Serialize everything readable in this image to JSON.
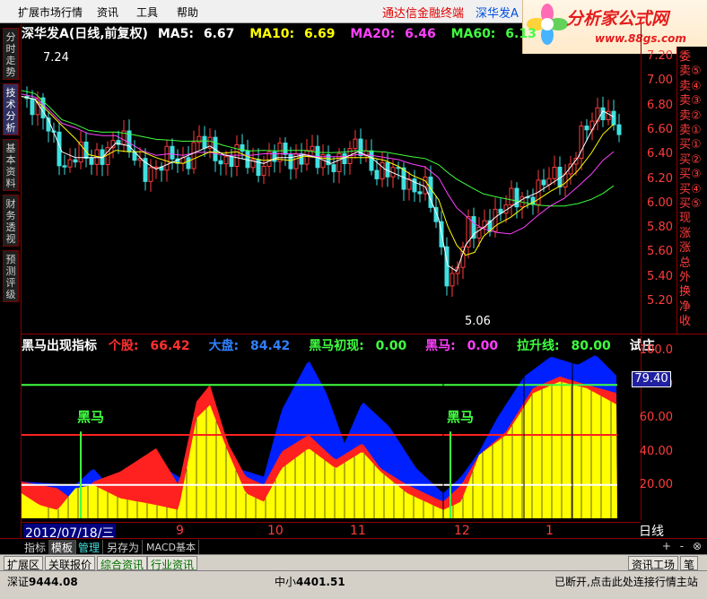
{
  "menu": {
    "items": [
      "扩展市场行情",
      "资讯",
      "工具",
      "帮助"
    ]
  },
  "window": {
    "brand_title": "通达信金融终端",
    "stock_title": "深华发A"
  },
  "logo": {
    "text": "分析家公式网",
    "url": "www.88gs.com"
  },
  "left_tabs": [
    "分时走势",
    "技术分析",
    "基本资料",
    "财务透视",
    "预测评级"
  ],
  "price_chart": {
    "title": "深华发A",
    "mode": "(日线,前复权)",
    "ma": [
      {
        "label": "MA5:",
        "value": "6.67",
        "color": "#ffffff"
      },
      {
        "label": "MA10:",
        "value": "6.69",
        "color": "#ffff00"
      },
      {
        "label": "MA20:",
        "value": "6.46",
        "color": "#ff40ff"
      },
      {
        "label": "MA60:",
        "value": "6.13",
        "color": "#40ff40"
      }
    ],
    "high_marker": "7.24",
    "low_marker": "5.06",
    "price_axis": [
      "7.20",
      "7.00",
      "6.80",
      "6.60",
      "6.40",
      "6.20",
      "6.00",
      "5.80",
      "5.60",
      "5.40",
      "5.20"
    ]
  },
  "order_book": [
    "委",
    "卖⑤",
    "卖④",
    "卖③",
    "卖②",
    "卖①",
    "买①",
    "买②",
    "买③",
    "买④",
    "买⑤",
    "现",
    "涨",
    "涨",
    "总",
    "外",
    "换",
    "净",
    "收"
  ],
  "indicator": {
    "name": "黑马出现指标",
    "items": [
      {
        "label": "个股:",
        "value": "66.42",
        "color": "#ff3030"
      },
      {
        "label": "大盘:",
        "value": "84.42",
        "color": "#3080ff"
      },
      {
        "label": "黑马初现:",
        "value": "0.00",
        "color": "#40ff40"
      },
      {
        "label": "黑马:",
        "value": "0.00",
        "color": "#ff40ff"
      },
      {
        "label": "拉升线:",
        "value": "80.00",
        "color": "#40ff40"
      }
    ],
    "extra": "试庄",
    "axis": [
      "100.0",
      "80.00",
      "60.00",
      "40.00",
      "20.00"
    ],
    "current_value": "79.40",
    "signal_label": "黑马"
  },
  "date_bar": {
    "current": "2012/07/18/三",
    "months": [
      "9",
      "10",
      "11",
      "12",
      "1"
    ],
    "period": "日线"
  },
  "bottom_tabs": [
    "指标",
    "模板",
    "管理",
    "另存为",
    "MACD基本"
  ],
  "zoom_controls": [
    "+",
    "-",
    "⊗"
  ],
  "tab_bar2": {
    "items": [
      "扩展区",
      "关联报价",
      "综合资讯",
      "行业资讯"
    ],
    "right": [
      "资讯工场",
      "笔"
    ]
  },
  "status": {
    "sz_label": "深证",
    "sz_value": "9444.08",
    "zx_label": "中小",
    "zx_value": "4401.51",
    "connection": "已断开,点击此处连接行情主站"
  }
}
